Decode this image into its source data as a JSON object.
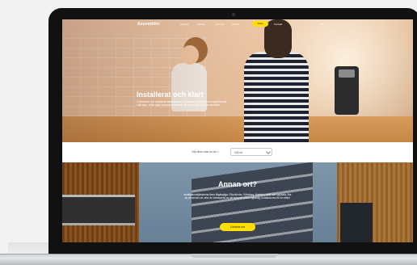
{
  "header": {
    "logo": "Assemblin",
    "nav": [
      "Support",
      "Tjänster",
      "Om oss",
      "Karriär",
      "Kontakt",
      "SV"
    ],
    "cta": "Boka"
  },
  "hero": {
    "title": "Installerat och klart",
    "text": "Vi levererar och installerar laddstationer, ventilation, solceller och mycket annat i ditt hem. Vi tar hand om hela processen så att du kan njuta av resultatet."
  },
  "selector": {
    "label": "Välj vilken stad du bor i:",
    "value": "Välj ort"
  },
  "section": {
    "title": "Annan ort?",
    "text": "Installationstjänsterna finns tillgängliga i Stockholm, Göteborg, Malmö, Luleå och Uppsala. Bor du på annan ort, eller är intresserad av att boka ett större uppdrag, kontakta oss för en offert.",
    "button": "Kontakta oss"
  },
  "colors": {
    "accent": "#ffe000",
    "bezel": "#111111"
  }
}
